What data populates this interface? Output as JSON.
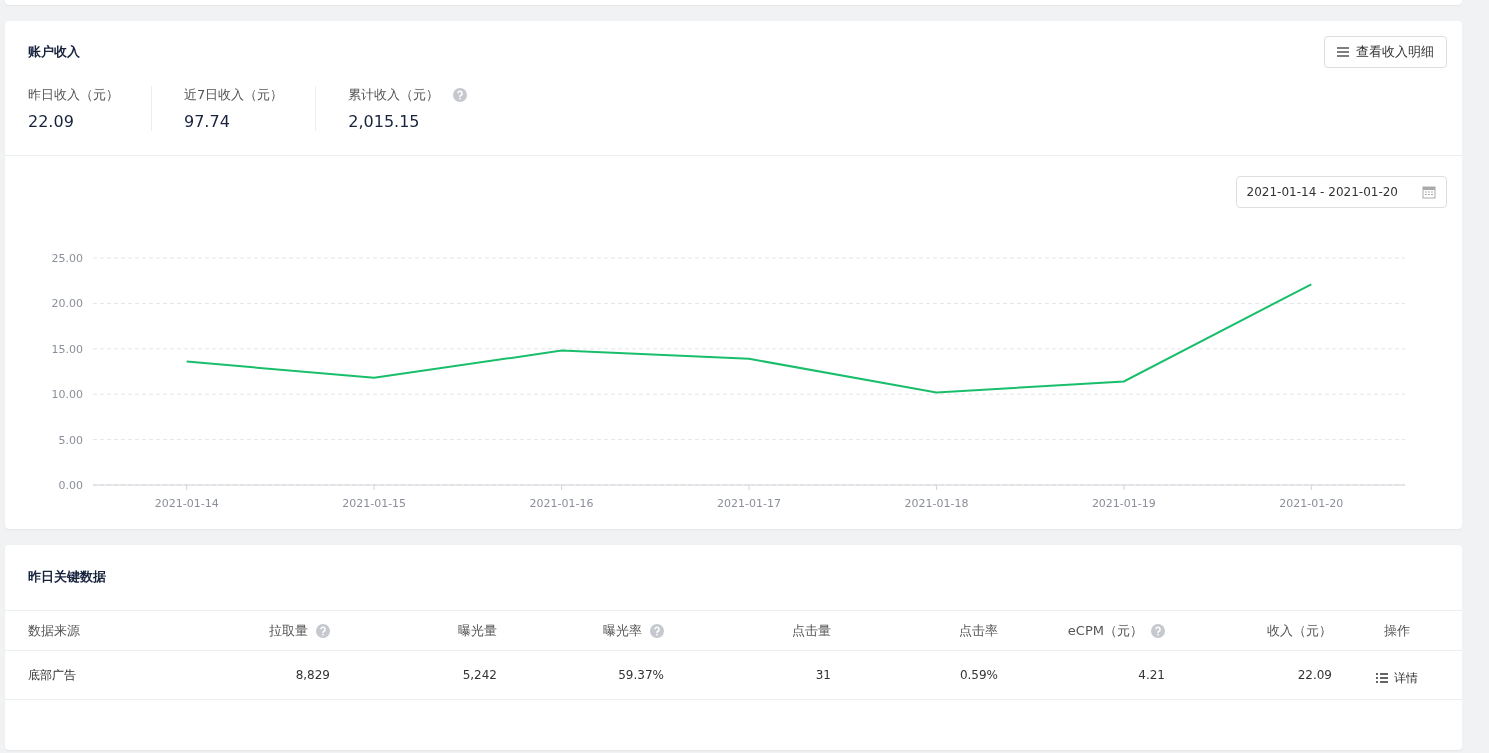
{
  "income": {
    "title": "账户收入",
    "detail_button": "查看收入明细",
    "stats": [
      {
        "label": "昨日收入（元）",
        "value": "22.09",
        "help": false
      },
      {
        "label": "近7日收入（元）",
        "value": "97.74",
        "help": false
      },
      {
        "label": "累计收入（元）",
        "value": "2,015.15",
        "help": true
      }
    ],
    "date_range": "2021-01-14 - 2021-01-20",
    "chart_data": {
      "type": "line",
      "categories": [
        "2021-01-14",
        "2021-01-15",
        "2021-01-16",
        "2021-01-17",
        "2021-01-18",
        "2021-01-19",
        "2021-01-20"
      ],
      "series": [
        {
          "color": "#19be6b",
          "values": [
            13.6,
            11.8,
            14.8,
            13.9,
            10.2,
            11.4,
            22.1
          ]
        }
      ],
      "grid": true,
      "ylim": [
        0,
        25
      ],
      "yticks": [
        {
          "value": 0,
          "label": "0.00"
        },
        {
          "value": 5,
          "label": "5.00"
        },
        {
          "value": 10,
          "label": "10.00"
        },
        {
          "value": 15,
          "label": "15.00"
        },
        {
          "value": 20,
          "label": "20.00"
        },
        {
          "value": 25,
          "label": "25.00"
        }
      ]
    }
  },
  "key_data": {
    "title": "昨日关键数据",
    "columns": [
      {
        "label": "数据来源",
        "help": false
      },
      {
        "label": "拉取量",
        "help": true
      },
      {
        "label": "曝光量",
        "help": false
      },
      {
        "label": "曝光率",
        "help": true
      },
      {
        "label": "点击量",
        "help": false
      },
      {
        "label": "点击率",
        "help": false
      },
      {
        "label": "eCPM（元）",
        "help": true
      },
      {
        "label": "收入（元）",
        "help": false
      },
      {
        "label": "操作",
        "help": false
      }
    ],
    "rows": [
      {
        "cells": [
          "底部广告",
          "8,829",
          "5,242",
          "59.37%",
          "31",
          "0.59%",
          "4.21",
          "22.09"
        ],
        "action": "详情"
      }
    ]
  }
}
